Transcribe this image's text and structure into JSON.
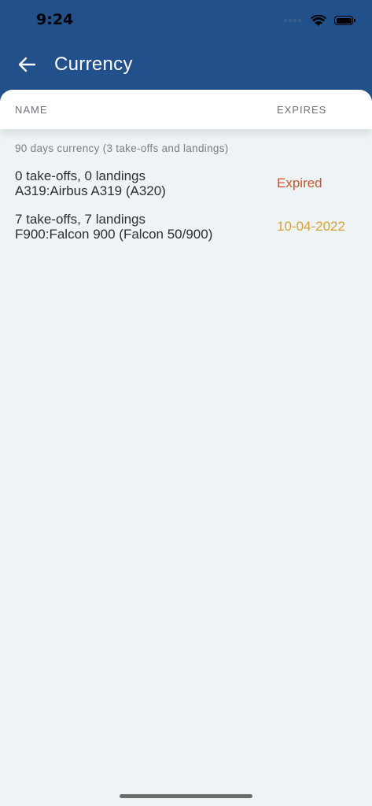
{
  "status_bar": {
    "time": "9:24"
  },
  "header": {
    "title": "Currency"
  },
  "columns": {
    "name": "NAME",
    "expires": "EXPIRES"
  },
  "section": {
    "title": "90 days currency (3 take-offs and landings)"
  },
  "rows": [
    {
      "line1": "0 take-offs, 0 landings",
      "line2": "A319:Airbus A319 (A320)",
      "status": "Expired",
      "status_color": "#c9552e"
    },
    {
      "line1": "7 take-offs, 7 landings",
      "line2": "F900:Falcon 900 (Falcon 50/900)",
      "status": "10-04-2022",
      "status_color": "#d4a238"
    }
  ],
  "colors": {
    "header_bg": "#22508a",
    "page_bg": "#eef3f6"
  },
  "icons": {
    "back": "arrow-left-icon",
    "wifi": "wifi-icon",
    "battery": "battery-icon",
    "signal": "cellular-signal-icon"
  }
}
